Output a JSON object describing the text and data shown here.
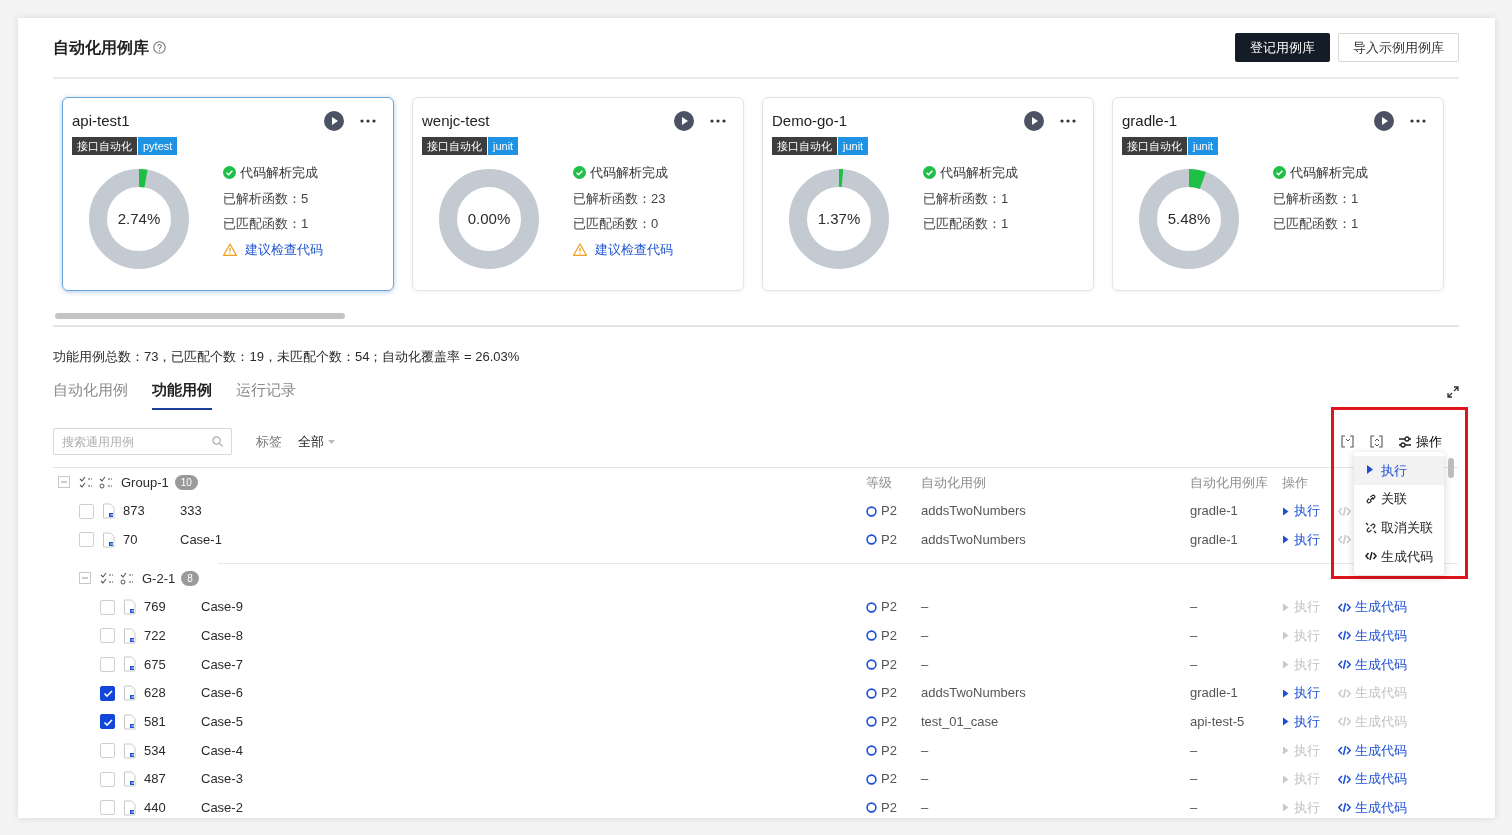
{
  "header": {
    "title": "自动化用例库",
    "buttons": [
      {
        "label": "登记用例库",
        "kind": "primary"
      },
      {
        "label": "导入示例用例库",
        "kind": "secondary"
      }
    ]
  },
  "libraries": [
    {
      "name": "api-test1",
      "selected": true,
      "tags": [
        {
          "label": "接口自动化",
          "kind": "category"
        },
        {
          "label": "pytest",
          "kind": "framework"
        }
      ],
      "coverage": "2.74%",
      "level": 0.0274,
      "status": "代码解析完成",
      "stats": [
        {
          "label": "已解析函数：",
          "value": "5"
        },
        {
          "label": "已匹配函数：",
          "value": "1"
        }
      ],
      "warning": "建议检查代码"
    },
    {
      "name": "wenjc-test",
      "selected": false,
      "tags": [
        {
          "label": "接口自动化",
          "kind": "category"
        },
        {
          "label": "junit",
          "kind": "framework"
        }
      ],
      "coverage": "0.00%",
      "level": 0,
      "status": "代码解析完成",
      "stats": [
        {
          "label": "已解析函数：",
          "value": "23"
        },
        {
          "label": "已匹配函数：",
          "value": "0"
        }
      ],
      "warning": "建议检查代码"
    },
    {
      "name": "Demo-go-1",
      "selected": false,
      "tags": [
        {
          "label": "接口自动化",
          "kind": "category"
        },
        {
          "label": "junit",
          "kind": "framework"
        }
      ],
      "coverage": "1.37%",
      "level": 0.0137,
      "status": "代码解析完成",
      "stats": [
        {
          "label": "已解析函数：",
          "value": "1"
        },
        {
          "label": "已匹配函数：",
          "value": "1"
        }
      ]
    },
    {
      "name": "gradle-1",
      "selected": false,
      "tags": [
        {
          "label": "接口自动化",
          "kind": "category"
        },
        {
          "label": "junit",
          "kind": "framework"
        }
      ],
      "coverage": "5.48%",
      "level": 0.0548,
      "status": "代码解析完成",
      "stats": [
        {
          "label": "已解析函数：",
          "value": "1"
        },
        {
          "label": "已匹配函数：",
          "value": "1"
        }
      ]
    }
  ],
  "summary": "功能用例总数：73，已匹配个数：19，未匹配个数：54；自动化覆盖率 = 26.03%",
  "tabs": [
    {
      "label": "自动化用例",
      "selected": false
    },
    {
      "label": "功能用例",
      "selected": true
    },
    {
      "label": "运行记录",
      "selected": false
    }
  ],
  "filters": {
    "search_placeholder": "搜索通用用例",
    "tag_label": "标签",
    "tag_value": "全部"
  },
  "toolbar": {
    "action_label": "操作",
    "highlighted": true
  },
  "table": {
    "columns": [
      "等级",
      "自动化用例",
      "自动化用例库",
      "操作"
    ],
    "tree": [
      {
        "kind": "group",
        "name": "Group-1",
        "count": "10",
        "expanded": true,
        "children": [
          {
            "kind": "case",
            "id": "873",
            "title": "333",
            "checked": false,
            "priority": "P2",
            "auto_case": "addsTwoNumbers",
            "library": "gradle-1",
            "run": {
              "label": "执行",
              "enabled": true
            },
            "generate": {
              "enabled": false
            }
          },
          {
            "kind": "case",
            "id": "70",
            "title": "Case-1",
            "checked": false,
            "priority": "P2",
            "auto_case": "addsTwoNumbers",
            "library": "gradle-1",
            "run": {
              "label": "执行",
              "enabled": true
            },
            "generate": {
              "enabled": false
            }
          },
          {
            "kind": "group",
            "name": "G-2-1",
            "count": "8",
            "expanded": true,
            "children": [
              {
                "kind": "case",
                "id": "769",
                "title": "Case-9",
                "checked": false,
                "priority": "P2",
                "auto_case": "–",
                "library": "–",
                "run": {
                  "label": "执行",
                  "enabled": false
                },
                "generate": {
                  "label": "生成代码",
                  "enabled": true
                }
              },
              {
                "kind": "case",
                "id": "722",
                "title": "Case-8",
                "checked": false,
                "priority": "P2",
                "auto_case": "–",
                "library": "–",
                "run": {
                  "label": "执行",
                  "enabled": false
                },
                "generate": {
                  "label": "生成代码",
                  "enabled": true
                }
              },
              {
                "kind": "case",
                "id": "675",
                "title": "Case-7",
                "checked": false,
                "priority": "P2",
                "auto_case": "–",
                "library": "–",
                "run": {
                  "label": "执行",
                  "enabled": false
                },
                "generate": {
                  "label": "生成代码",
                  "enabled": true
                }
              },
              {
                "kind": "case",
                "id": "628",
                "title": "Case-6",
                "checked": true,
                "priority": "P2",
                "auto_case": "addsTwoNumbers",
                "library": "gradle-1",
                "run": {
                  "label": "执行",
                  "enabled": true
                },
                "generate": {
                  "label": "生成代码",
                  "enabled": false
                }
              },
              {
                "kind": "case",
                "id": "581",
                "title": "Case-5",
                "checked": true,
                "priority": "P2",
                "auto_case": "test_01_case",
                "library": "api-test-5",
                "run": {
                  "label": "执行",
                  "enabled": true
                },
                "generate": {
                  "label": "生成代码",
                  "enabled": false
                }
              },
              {
                "kind": "case",
                "id": "534",
                "title": "Case-4",
                "checked": false,
                "priority": "P2",
                "auto_case": "–",
                "library": "–",
                "run": {
                  "label": "执行",
                  "enabled": false
                },
                "generate": {
                  "label": "生成代码",
                  "enabled": true
                }
              },
              {
                "kind": "case",
                "id": "487",
                "title": "Case-3",
                "checked": false,
                "priority": "P2",
                "auto_case": "–",
                "library": "–",
                "run": {
                  "label": "执行",
                  "enabled": false
                },
                "generate": {
                  "label": "生成代码",
                  "enabled": true
                }
              },
              {
                "kind": "case",
                "id": "440",
                "title": "Case-2",
                "checked": false,
                "priority": "P2",
                "auto_case": "–",
                "library": "–",
                "run": {
                  "label": "执行",
                  "enabled": false
                },
                "generate": {
                  "label": "生成代码",
                  "enabled": true
                }
              }
            ]
          }
        ]
      }
    ]
  },
  "action_menu": {
    "items": [
      {
        "label": "执行",
        "kind": "run",
        "selected": true
      },
      {
        "label": "关联",
        "kind": "link",
        "selected": false
      },
      {
        "label": "取消关联",
        "kind": "unlink",
        "selected": false
      },
      {
        "label": "生成代码",
        "kind": "code",
        "selected": false
      }
    ]
  }
}
